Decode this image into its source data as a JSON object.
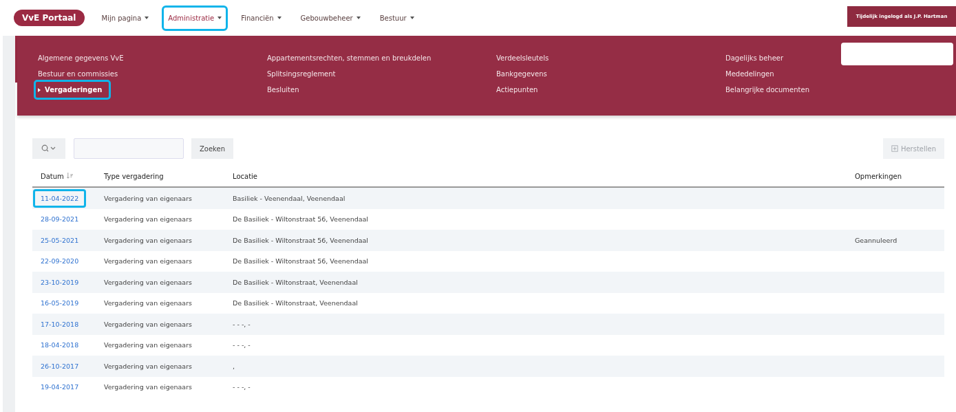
{
  "brand": "VvE Portaal",
  "nav": [
    {
      "label": "Mijn pagina",
      "selected": false,
      "highlighted": false
    },
    {
      "label": "Administratie",
      "selected": true,
      "highlighted": true
    },
    {
      "label": "Financiën",
      "selected": false,
      "highlighted": false
    },
    {
      "label": "Gebouwbeheer",
      "selected": false,
      "highlighted": false
    },
    {
      "label": "Bestuur",
      "selected": false,
      "highlighted": false
    }
  ],
  "user_button": "Tijdelijk ingelogd als J.P. Hartman",
  "menu_columns": [
    {
      "items": [
        {
          "label": "Algemene gegevens VvE",
          "selected": false,
          "highlighted": false
        },
        {
          "label": "Bestuur en commissies",
          "selected": false,
          "highlighted": false
        },
        {
          "label": "Vergaderingen",
          "selected": true,
          "highlighted": true
        }
      ]
    },
    {
      "items": [
        {
          "label": "Appartementsrechten, stemmen en breukdelen",
          "selected": false,
          "highlighted": false
        },
        {
          "label": "Splitsingsreglement",
          "selected": false,
          "highlighted": false
        },
        {
          "label": "Besluiten",
          "selected": false,
          "highlighted": false
        }
      ]
    },
    {
      "items": [
        {
          "label": "Verdeelsleutels",
          "selected": false,
          "highlighted": false
        },
        {
          "label": "Bankgegevens",
          "selected": false,
          "highlighted": false
        },
        {
          "label": "Actiepunten",
          "selected": false,
          "highlighted": false
        }
      ]
    },
    {
      "items": [
        {
          "label": "Dagelijks beheer",
          "selected": false,
          "highlighted": false
        },
        {
          "label": "Mededelingen",
          "selected": false,
          "highlighted": false
        },
        {
          "label": "Belangrijke documenten",
          "selected": false,
          "highlighted": false
        }
      ]
    }
  ],
  "search_button": "Zoeken",
  "reset_button": {
    "label": "Herstellen",
    "disabled": true
  },
  "table": {
    "columns": [
      "Datum",
      "Type vergadering",
      "Locatie",
      "Opmerkingen"
    ],
    "rows": [
      {
        "date": "11-04-2022",
        "type": "Vergadering van eigenaars",
        "location": "Basiliek - Veenendaal, Veenendaal",
        "highlighted": true
      },
      {
        "date": "28-09-2021",
        "type": "Vergadering van eigenaars",
        "location": "De Basiliek - Wiltonstraat 56, Veenendaal",
        "highlighted": false
      },
      {
        "date": "25-05-2021",
        "type": "Vergadering van eigenaars",
        "location": "De Basiliek - Wiltonstraat 56, Veenendaal",
        "remarks": "Geannuleerd",
        "highlighted": false
      },
      {
        "date": "22-09-2020",
        "type": "Vergadering van eigenaars",
        "location": "De Basiliek - Wiltonstraat 56, Veenendaal",
        "highlighted": false
      },
      {
        "date": "23-10-2019",
        "type": "Vergadering van eigenaars",
        "location": "De Basiliek - Wiltonstraat, Veenendaal",
        "highlighted": false
      },
      {
        "date": "16-05-2019",
        "type": "Vergadering van eigenaars",
        "location": "De Basiliek - Wiltonstraat, Veenendaal",
        "highlighted": false
      },
      {
        "date": "17-10-2018",
        "type": "Vergadering van eigenaars",
        "location": "- - -, -",
        "highlighted": false
      },
      {
        "date": "18-04-2018",
        "type": "Vergadering van eigenaars",
        "location": "- - -, -",
        "highlighted": false
      },
      {
        "date": "26-10-2017",
        "type": "Vergadering van eigenaars",
        "location": ",",
        "highlighted": false
      },
      {
        "date": "19-04-2017",
        "type": "Vergadering van eigenaars",
        "location": "- - -, -",
        "highlighted": false
      }
    ]
  }
}
